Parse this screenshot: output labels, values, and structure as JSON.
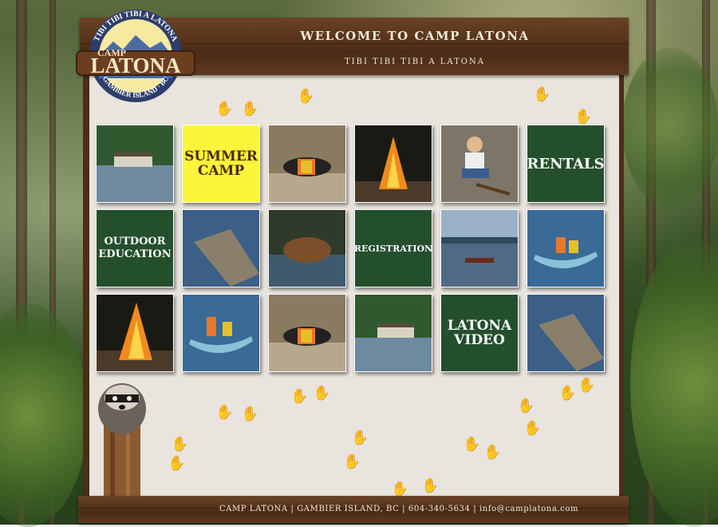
{
  "site": {
    "logo_top": "TIBI TIBI TIBI A LATONA",
    "logo_camp": "CAMP",
    "logo_name": "LATONA",
    "logo_bottom": "GAMBIER ISLAND · BC"
  },
  "header": {
    "welcome": "WELCOME TO CAMP LATONA",
    "tagline": "TIBI TIBI TIBI A LATONA"
  },
  "tiles": {
    "summer_camp": "SUMMER CAMP",
    "rentals": "RENTALS",
    "outdoor_education": "OUTDOOR EDUCATION",
    "registration": "REGISTRATION",
    "latona_video": "LATONA VIDEO"
  },
  "photos": {
    "lakeside": "lakeside-lodge-photo",
    "caterpillar": "caterpillar-photo",
    "campfire": "campfire-photo",
    "child": "child-photo",
    "dock": "dock-photo",
    "beaver": "beaver-photo",
    "sunset": "lake-sunset-photo",
    "canoe": "canoe-photo"
  },
  "footer": {
    "text": "CAMP LATONA  |  GAMBIER ISLAND, BC  |  604-340-5634  |  info@camplatona.com"
  },
  "colors": {
    "tile_green": "#244f2c",
    "tile_yellow": "#fbf53c",
    "wood": "#55331b",
    "paper": "#e9e4de"
  }
}
